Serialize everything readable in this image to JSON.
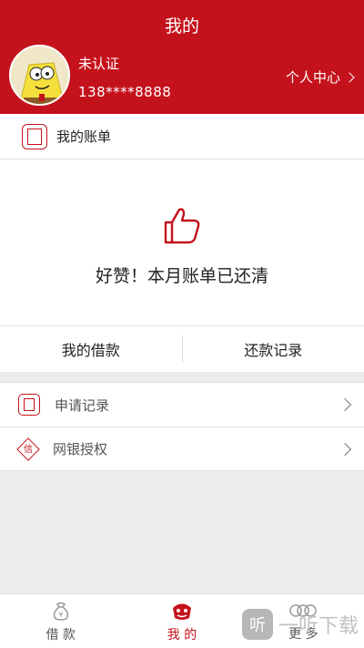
{
  "header": {
    "title": "我的"
  },
  "user": {
    "status": "未认证",
    "phone": "138****8888",
    "center_label": "个人中心"
  },
  "bill": {
    "heading": "我的账单",
    "message": "好赞！本月账单已还清",
    "tabs": [
      {
        "label": "我的借款"
      },
      {
        "label": "还款记录"
      }
    ]
  },
  "menu": {
    "items": [
      {
        "label": "申请记录",
        "icon": "seal-icon"
      },
      {
        "label": "网银授权",
        "icon": "credit-icon",
        "icon_char": "信"
      }
    ]
  },
  "bottom_nav": {
    "items": [
      {
        "label": "借 款",
        "icon": "money-bag-icon"
      },
      {
        "label": "我 的",
        "icon": "lion-mask-icon",
        "active": true
      },
      {
        "label": "更 多",
        "icon": "coins-icon"
      }
    ]
  },
  "watermark": {
    "badge": "听",
    "text": "一听下载"
  },
  "colors": {
    "brand": "#c4121c",
    "background": "#ececee"
  }
}
